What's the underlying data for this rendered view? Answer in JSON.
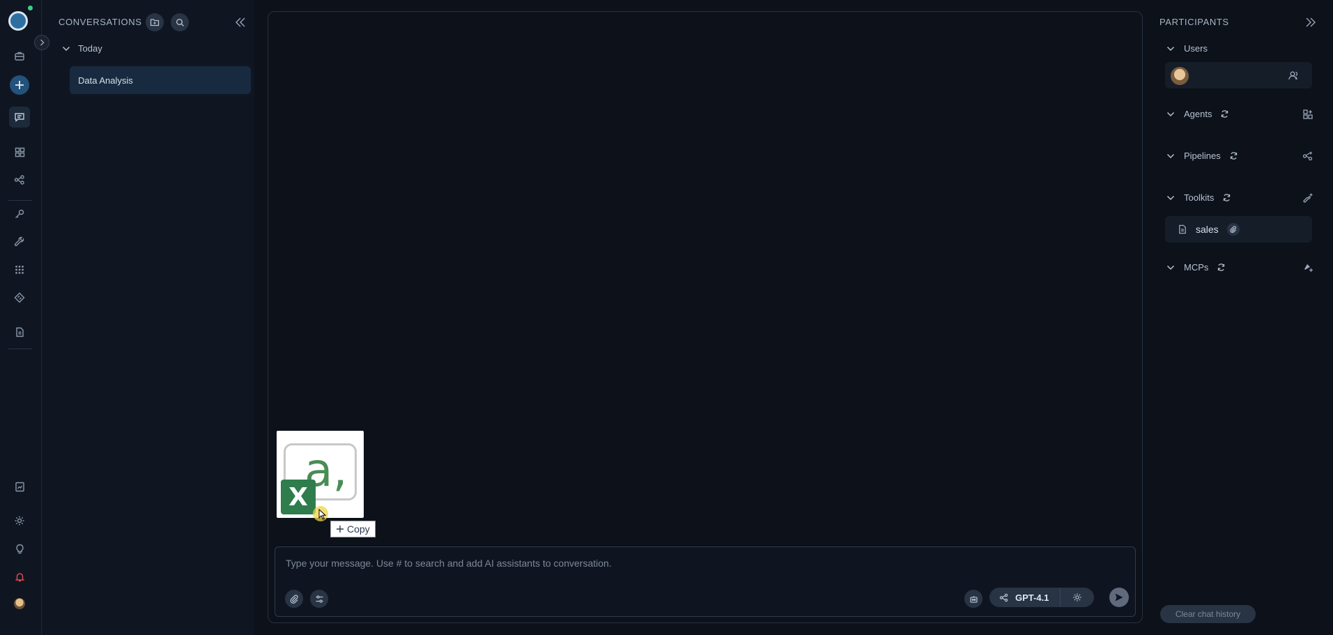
{
  "rail": {
    "icons": [
      "logo-icon",
      "expand-icon",
      "briefcase-icon",
      "plus-icon",
      "chat-icon",
      "grid-icon",
      "pipeline-icon",
      "key-icon",
      "wrench-icon",
      "apps-icon",
      "ticket-icon",
      "document-icon",
      "report-icon",
      "settings-icon",
      "lightbulb-icon",
      "bell-icon",
      "avatar"
    ],
    "active": "chat-icon",
    "accent": "#23527a",
    "bell_color": "#e0484f"
  },
  "conversations": {
    "title": "CONVERSATIONS",
    "group_label": "Today",
    "items": [
      {
        "label": "Data Analysis",
        "selected": true
      }
    ]
  },
  "chat": {
    "attachment": {
      "icon": "excel-file-icon",
      "tooltip_label": "Copy"
    },
    "composer": {
      "placeholder": "Type your message. Use # to search and add AI assistants to conversation.",
      "model_label": "GPT-4.1"
    }
  },
  "participants": {
    "title": "PARTICIPANTS",
    "sections": {
      "users": "Users",
      "agents": "Agents",
      "pipelines": "Pipelines",
      "toolkits": "Toolkits",
      "mcps": "MCPs"
    },
    "toolkit_items": [
      {
        "label": "sales"
      }
    ],
    "clear_label": "Clear chat history"
  }
}
